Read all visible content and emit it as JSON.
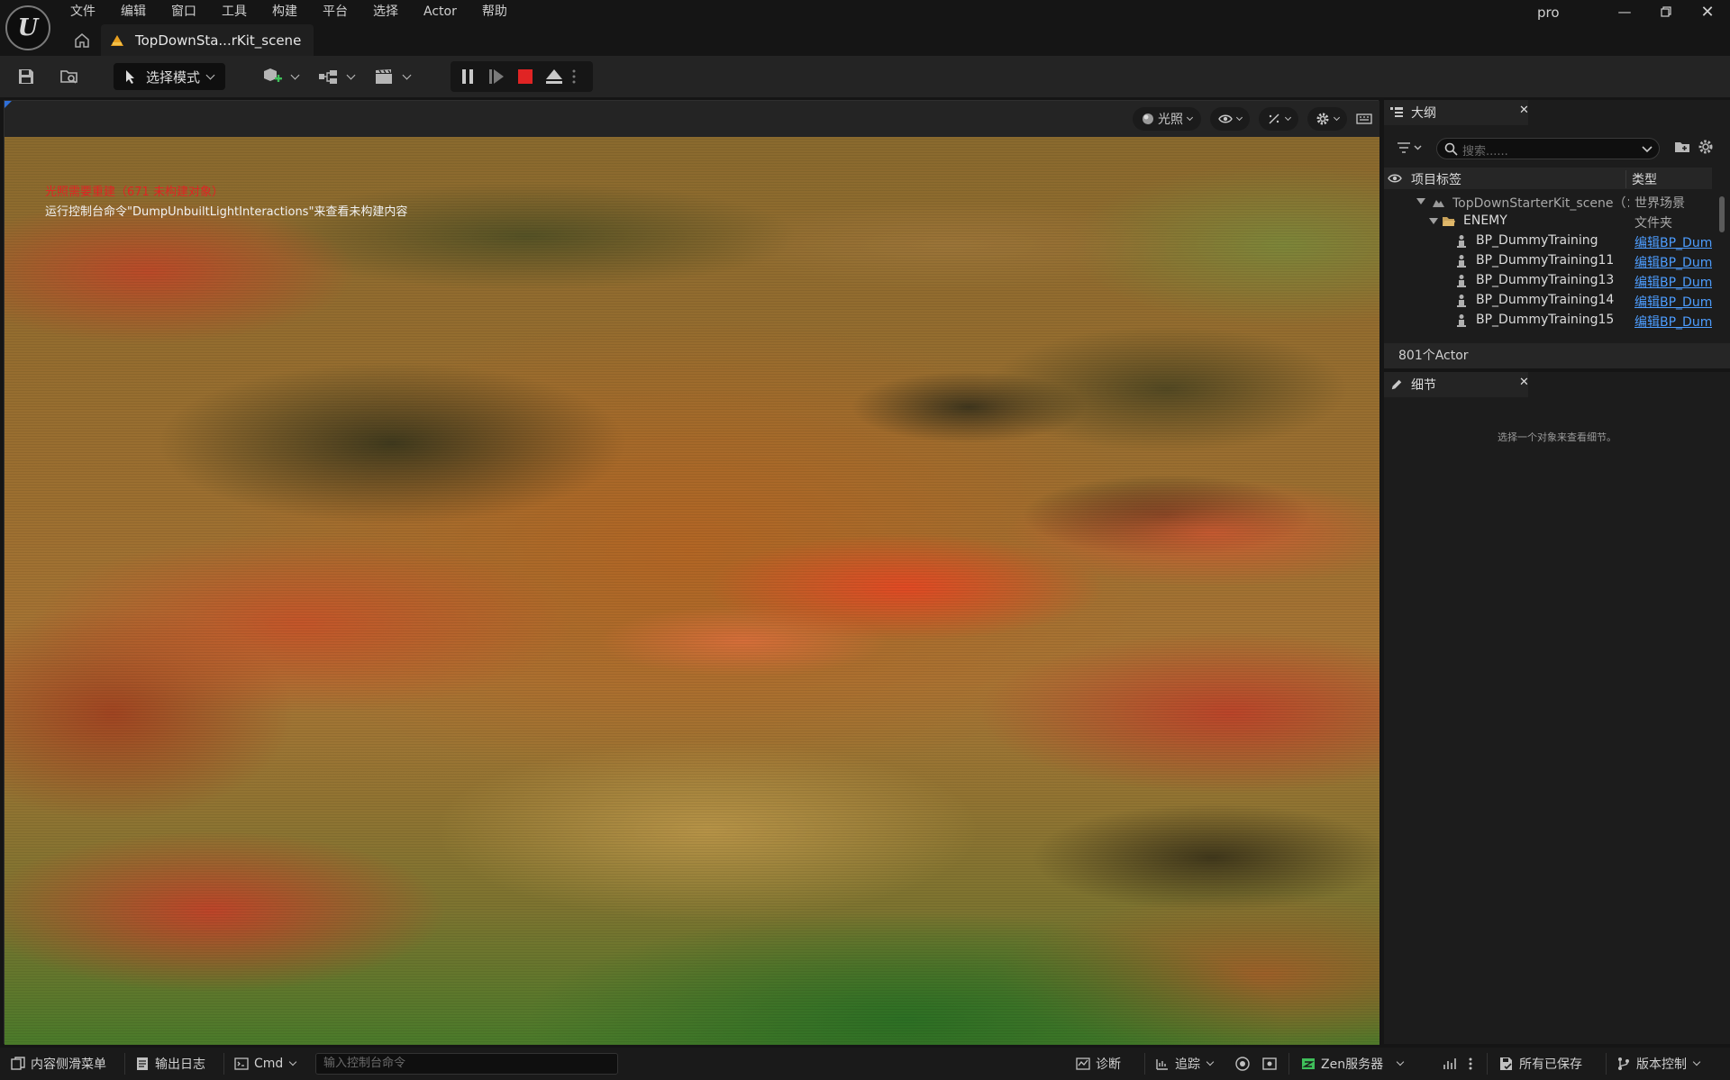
{
  "app": {
    "menu": [
      "文件",
      "编辑",
      "窗口",
      "工具",
      "构建",
      "平台",
      "选择",
      "Actor",
      "帮助"
    ],
    "project": "pro",
    "level_tab": "TopDownSta...rKit_scene"
  },
  "toolbar": {
    "mode_label": "选择模式"
  },
  "viewport": {
    "lighting_label": "光照",
    "message_error": "光照需要重建（671 未构建对象）",
    "message_info": "运行控制台命令\"DumpUnbuiltLightInteractions\"来查看未构建内容"
  },
  "outliner": {
    "title": "大纲",
    "search_placeholder": "搜索......",
    "col_label": "项目标签",
    "col_type": "类型",
    "rows": [
      {
        "name": "TopDownStarterKit_scene（：",
        "type": "世界场景"
      },
      {
        "name": "ENEMY",
        "type": "文件夹"
      },
      {
        "name": "BP_DummyTraining",
        "type": "编辑BP_Dum"
      },
      {
        "name": "BP_DummyTraining11",
        "type": "编辑BP_Dum"
      },
      {
        "name": "BP_DummyTraining13",
        "type": "编辑BP_Dum"
      },
      {
        "name": "BP_DummyTraining14",
        "type": "编辑BP_Dum"
      },
      {
        "name": "BP_DummyTraining15",
        "type": "编辑BP_Dum"
      }
    ],
    "footer": "801个Actor"
  },
  "details": {
    "title": "细节",
    "empty_text": "选择一个对象来查看细节。"
  },
  "statusbar": {
    "content_drawer": "内容侧滑菜单",
    "output_log": "输出日志",
    "cmd": "Cmd",
    "cmd_placeholder": "输入控制台命令",
    "diagnostics": "诊断",
    "trace": "追踪",
    "zen_server": "Zen服务器",
    "all_saved": "所有已保存",
    "source_control": "版本控制"
  },
  "colors": {
    "accent_link": "#4d9dff",
    "error_text": "#e02424",
    "stop_button": "#e02424",
    "zen_icon": "#3fbf5a",
    "warning_icon": "#e8a020"
  },
  "icons": {
    "save": "save-icon",
    "browse": "folder-browse-icon",
    "add_actor": "add-actor-icon",
    "blueprint": "blueprint-icon",
    "cinematics": "clapperboard-icon",
    "pause": "pause-icon",
    "step": "frame-advance-icon",
    "stop": "stop-icon",
    "eject": "eject-icon"
  }
}
